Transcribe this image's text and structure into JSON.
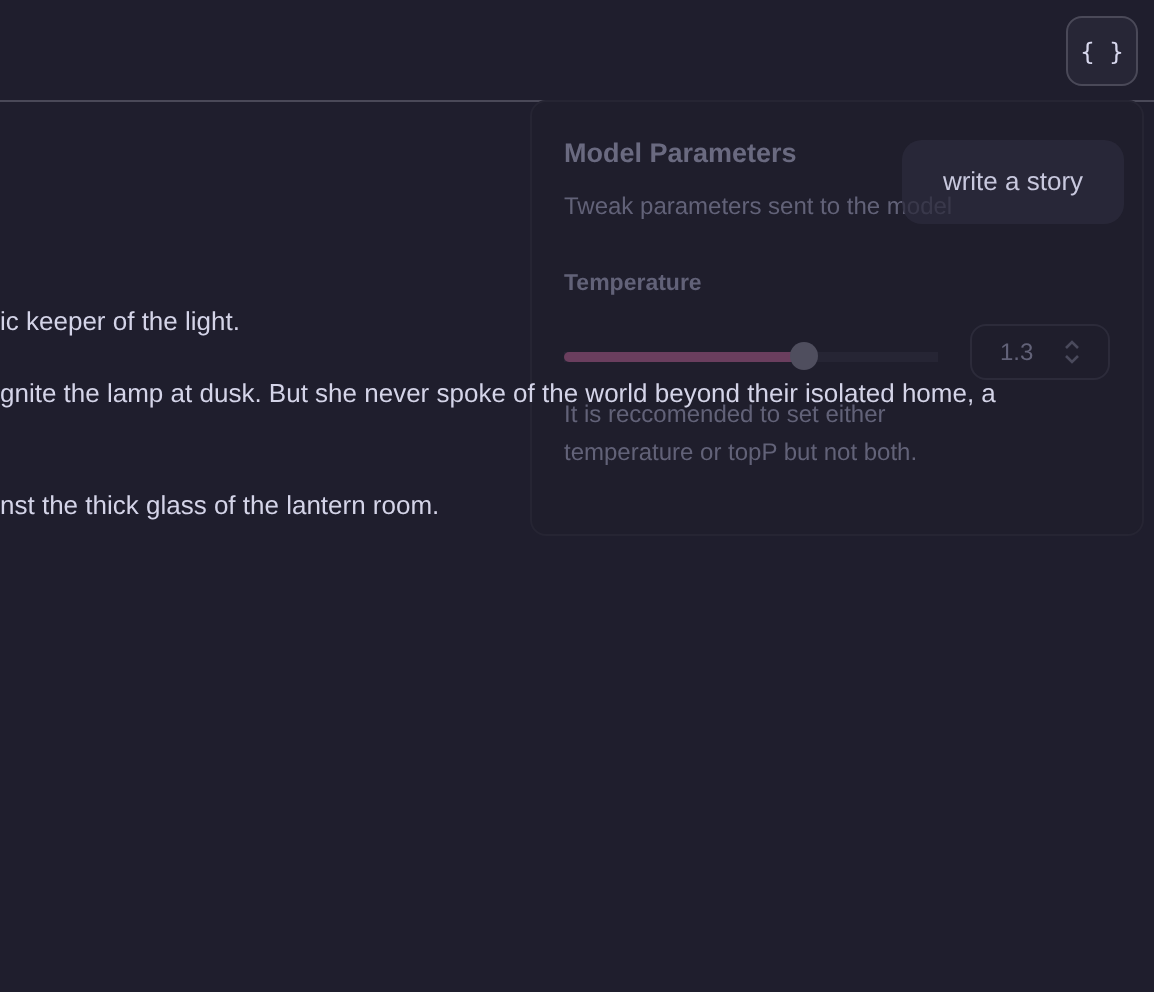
{
  "toolbar": {
    "json_button": "{ }"
  },
  "story": [
    "ic keeper of the light.",
    "gnite the lamp at dusk. But she never spoke of the world beyond their isolated home, a",
    "nst the thick glass of the lantern room."
  ],
  "tooltip": "write a story",
  "model_parameters": {
    "title": "Model Parameters",
    "description": "Tweak parameters sent to the model",
    "temperature": {
      "label": "Temperature",
      "level": 0.64,
      "value": "1.3"
    },
    "hint": "It is reccomended to set either temperature or topP but not both."
  }
}
